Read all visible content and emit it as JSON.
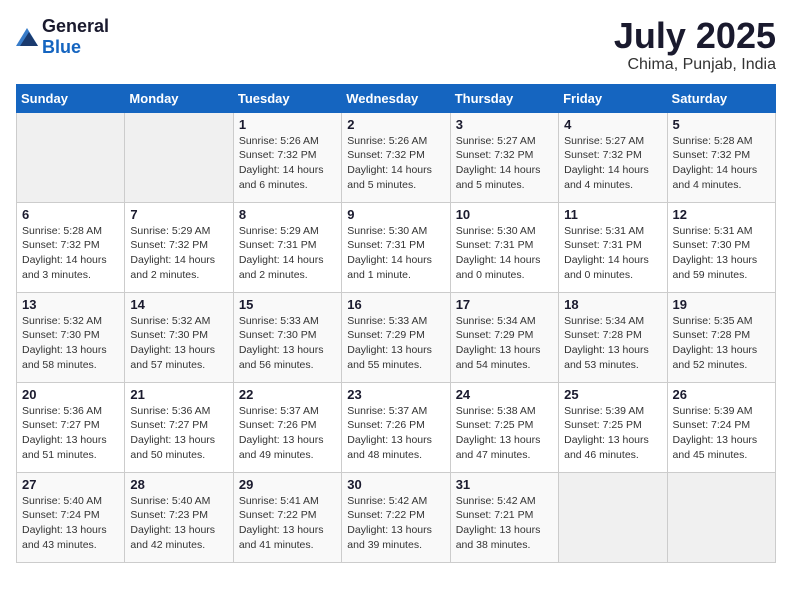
{
  "header": {
    "logo_general": "General",
    "logo_blue": "Blue",
    "month_year": "July 2025",
    "location": "Chima, Punjab, India"
  },
  "calendar": {
    "days_of_week": [
      "Sunday",
      "Monday",
      "Tuesday",
      "Wednesday",
      "Thursday",
      "Friday",
      "Saturday"
    ],
    "weeks": [
      [
        {
          "day": "",
          "empty": true
        },
        {
          "day": "",
          "empty": true
        },
        {
          "day": "1",
          "sunrise": "Sunrise: 5:26 AM",
          "sunset": "Sunset: 7:32 PM",
          "daylight": "Daylight: 14 hours and 6 minutes."
        },
        {
          "day": "2",
          "sunrise": "Sunrise: 5:26 AM",
          "sunset": "Sunset: 7:32 PM",
          "daylight": "Daylight: 14 hours and 5 minutes."
        },
        {
          "day": "3",
          "sunrise": "Sunrise: 5:27 AM",
          "sunset": "Sunset: 7:32 PM",
          "daylight": "Daylight: 14 hours and 5 minutes."
        },
        {
          "day": "4",
          "sunrise": "Sunrise: 5:27 AM",
          "sunset": "Sunset: 7:32 PM",
          "daylight": "Daylight: 14 hours and 4 minutes."
        },
        {
          "day": "5",
          "sunrise": "Sunrise: 5:28 AM",
          "sunset": "Sunset: 7:32 PM",
          "daylight": "Daylight: 14 hours and 4 minutes."
        }
      ],
      [
        {
          "day": "6",
          "sunrise": "Sunrise: 5:28 AM",
          "sunset": "Sunset: 7:32 PM",
          "daylight": "Daylight: 14 hours and 3 minutes."
        },
        {
          "day": "7",
          "sunrise": "Sunrise: 5:29 AM",
          "sunset": "Sunset: 7:32 PM",
          "daylight": "Daylight: 14 hours and 2 minutes."
        },
        {
          "day": "8",
          "sunrise": "Sunrise: 5:29 AM",
          "sunset": "Sunset: 7:31 PM",
          "daylight": "Daylight: 14 hours and 2 minutes."
        },
        {
          "day": "9",
          "sunrise": "Sunrise: 5:30 AM",
          "sunset": "Sunset: 7:31 PM",
          "daylight": "Daylight: 14 hours and 1 minute."
        },
        {
          "day": "10",
          "sunrise": "Sunrise: 5:30 AM",
          "sunset": "Sunset: 7:31 PM",
          "daylight": "Daylight: 14 hours and 0 minutes."
        },
        {
          "day": "11",
          "sunrise": "Sunrise: 5:31 AM",
          "sunset": "Sunset: 7:31 PM",
          "daylight": "Daylight: 14 hours and 0 minutes."
        },
        {
          "day": "12",
          "sunrise": "Sunrise: 5:31 AM",
          "sunset": "Sunset: 7:30 PM",
          "daylight": "Daylight: 13 hours and 59 minutes."
        }
      ],
      [
        {
          "day": "13",
          "sunrise": "Sunrise: 5:32 AM",
          "sunset": "Sunset: 7:30 PM",
          "daylight": "Daylight: 13 hours and 58 minutes."
        },
        {
          "day": "14",
          "sunrise": "Sunrise: 5:32 AM",
          "sunset": "Sunset: 7:30 PM",
          "daylight": "Daylight: 13 hours and 57 minutes."
        },
        {
          "day": "15",
          "sunrise": "Sunrise: 5:33 AM",
          "sunset": "Sunset: 7:30 PM",
          "daylight": "Daylight: 13 hours and 56 minutes."
        },
        {
          "day": "16",
          "sunrise": "Sunrise: 5:33 AM",
          "sunset": "Sunset: 7:29 PM",
          "daylight": "Daylight: 13 hours and 55 minutes."
        },
        {
          "day": "17",
          "sunrise": "Sunrise: 5:34 AM",
          "sunset": "Sunset: 7:29 PM",
          "daylight": "Daylight: 13 hours and 54 minutes."
        },
        {
          "day": "18",
          "sunrise": "Sunrise: 5:34 AM",
          "sunset": "Sunset: 7:28 PM",
          "daylight": "Daylight: 13 hours and 53 minutes."
        },
        {
          "day": "19",
          "sunrise": "Sunrise: 5:35 AM",
          "sunset": "Sunset: 7:28 PM",
          "daylight": "Daylight: 13 hours and 52 minutes."
        }
      ],
      [
        {
          "day": "20",
          "sunrise": "Sunrise: 5:36 AM",
          "sunset": "Sunset: 7:27 PM",
          "daylight": "Daylight: 13 hours and 51 minutes."
        },
        {
          "day": "21",
          "sunrise": "Sunrise: 5:36 AM",
          "sunset": "Sunset: 7:27 PM",
          "daylight": "Daylight: 13 hours and 50 minutes."
        },
        {
          "day": "22",
          "sunrise": "Sunrise: 5:37 AM",
          "sunset": "Sunset: 7:26 PM",
          "daylight": "Daylight: 13 hours and 49 minutes."
        },
        {
          "day": "23",
          "sunrise": "Sunrise: 5:37 AM",
          "sunset": "Sunset: 7:26 PM",
          "daylight": "Daylight: 13 hours and 48 minutes."
        },
        {
          "day": "24",
          "sunrise": "Sunrise: 5:38 AM",
          "sunset": "Sunset: 7:25 PM",
          "daylight": "Daylight: 13 hours and 47 minutes."
        },
        {
          "day": "25",
          "sunrise": "Sunrise: 5:39 AM",
          "sunset": "Sunset: 7:25 PM",
          "daylight": "Daylight: 13 hours and 46 minutes."
        },
        {
          "day": "26",
          "sunrise": "Sunrise: 5:39 AM",
          "sunset": "Sunset: 7:24 PM",
          "daylight": "Daylight: 13 hours and 45 minutes."
        }
      ],
      [
        {
          "day": "27",
          "sunrise": "Sunrise: 5:40 AM",
          "sunset": "Sunset: 7:24 PM",
          "daylight": "Daylight: 13 hours and 43 minutes."
        },
        {
          "day": "28",
          "sunrise": "Sunrise: 5:40 AM",
          "sunset": "Sunset: 7:23 PM",
          "daylight": "Daylight: 13 hours and 42 minutes."
        },
        {
          "day": "29",
          "sunrise": "Sunrise: 5:41 AM",
          "sunset": "Sunset: 7:22 PM",
          "daylight": "Daylight: 13 hours and 41 minutes."
        },
        {
          "day": "30",
          "sunrise": "Sunrise: 5:42 AM",
          "sunset": "Sunset: 7:22 PM",
          "daylight": "Daylight: 13 hours and 39 minutes."
        },
        {
          "day": "31",
          "sunrise": "Sunrise: 5:42 AM",
          "sunset": "Sunset: 7:21 PM",
          "daylight": "Daylight: 13 hours and 38 minutes."
        },
        {
          "day": "",
          "empty": true
        },
        {
          "day": "",
          "empty": true
        }
      ]
    ]
  }
}
